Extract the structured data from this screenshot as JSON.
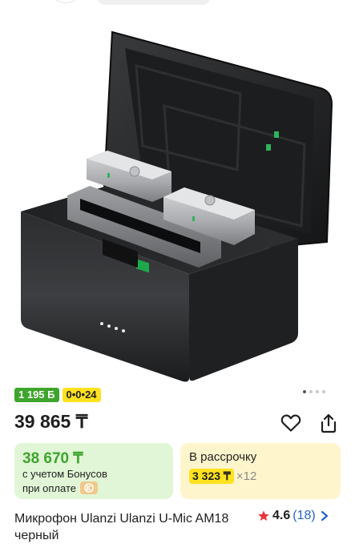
{
  "badges": {
    "bonus": "1 195 Б",
    "installment": "0•0•24"
  },
  "gallery": {
    "image_alt": "Микрофон Ulanzi Ulanzi U-Mic AM18 черный",
    "pages": 4,
    "active_page": 1
  },
  "price": "39 865 ₸",
  "bonus_card": {
    "price": "38 670 ₸",
    "line1": "с учетом Бонусов",
    "line2": "при оплате"
  },
  "installment_card": {
    "title": "В рассрочку",
    "amount": "3 323 ₸",
    "multiplier": "×12"
  },
  "product": {
    "title": "Микрофон Ulanzi Ulanzi U-Mic AM18 черный",
    "rating": "4.6",
    "reviews": "(18)"
  },
  "icons": {
    "favorite": "heart-icon",
    "share": "share-icon",
    "star": "star-icon",
    "chevron": "chevron-right-icon",
    "coin": "kaspi-logo-icon"
  },
  "colors": {
    "accent_green": "#3da52c",
    "accent_yellow": "#ffe21f",
    "star_red": "#e8373c",
    "link_blue": "#2763c4"
  }
}
